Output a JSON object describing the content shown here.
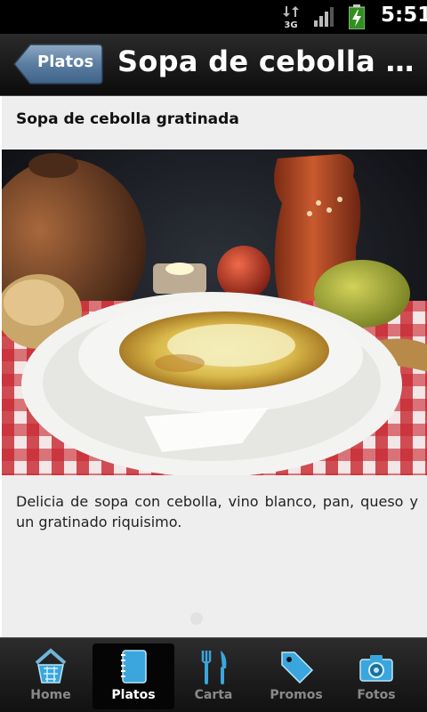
{
  "status_bar": {
    "network": "3G",
    "time": "5:51",
    "icons": [
      "3g-data-icon",
      "signal-icon",
      "battery-charging-icon"
    ]
  },
  "header": {
    "back_label": "Platos",
    "title": "Sopa de cebolla gratinada"
  },
  "dish": {
    "name": "Sopa de cebolla gratinada",
    "photo_icon": "soup-photo",
    "description": "Delicia de sopa con cebolla, vino blanco, pan, queso y un gratinado riquisimo."
  },
  "tabs": [
    {
      "label": "Home",
      "icon": "home-basket-icon",
      "active": false
    },
    {
      "label": "Platos",
      "icon": "notebook-icon",
      "active": true
    },
    {
      "label": "Carta",
      "icon": "fork-knife-icon",
      "active": false
    },
    {
      "label": "Promos",
      "icon": "price-tag-icon",
      "active": false
    },
    {
      "label": "Fotos",
      "icon": "camera-icon",
      "active": false
    }
  ],
  "colors": {
    "accent_blue": "#3aa6dd",
    "header_bg": "#1a1a1a",
    "content_bg": "#eeeeee"
  }
}
